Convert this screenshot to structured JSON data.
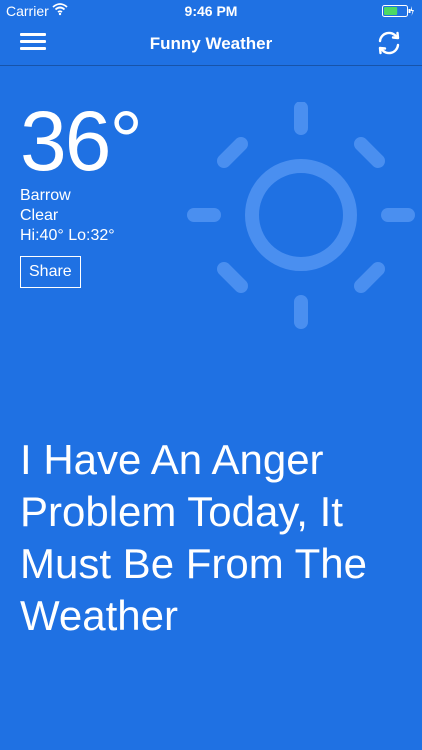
{
  "status_bar": {
    "carrier": "Carrier",
    "time": "9:46 PM",
    "battery_level": 0.6,
    "icons": [
      "wifi-icon",
      "battery-icon",
      "charging-icon"
    ]
  },
  "nav": {
    "title": "Funny Weather",
    "left_icon": "hamburger-menu-icon",
    "right_icon": "refresh-icon"
  },
  "weather": {
    "temperature": "36°",
    "location": "Barrow",
    "condition": "Clear",
    "hi_lo": "Hi:40° Lo:32°",
    "share_label": "Share",
    "condition_icon": "sun-icon"
  },
  "quote": "I Have An Anger Problem Today, It Must Be From The Weather",
  "colors": {
    "background": "#1f71e3",
    "sun_icon": "#4a8ff0",
    "text": "#ffffff",
    "battery_fill": "#4cd964"
  }
}
